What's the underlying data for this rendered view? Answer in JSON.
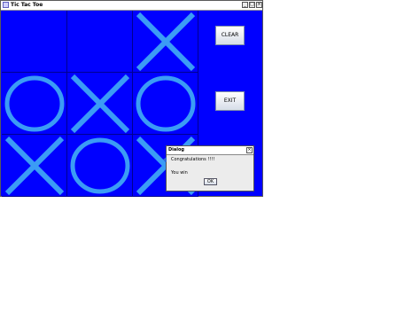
{
  "window": {
    "title": "Tic Tac Toe",
    "minimize_glyph": "_",
    "maximize_glyph": "□",
    "close_glyph": "×"
  },
  "board": {
    "cells": [
      "",
      "",
      "X",
      "O",
      "X",
      "O",
      "X",
      "O",
      "X"
    ],
    "colors": {
      "background": "#0000ff",
      "mark": "#3b9cf5",
      "grid": "#000090"
    }
  },
  "buttons": {
    "clear_label": "CLEAR",
    "exit_label": "EXIT"
  },
  "dialog": {
    "title": "Dialog",
    "close_glyph": "×",
    "message": "Congratulations !!!!",
    "submessage": "You win",
    "ok_label": "OK"
  }
}
